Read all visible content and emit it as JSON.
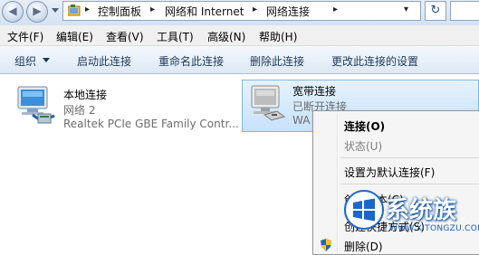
{
  "address_bar": {
    "breadcrumbs": [
      "控制面板",
      "网络和 Internet",
      "网络连接"
    ],
    "refresh_glyph": "↻"
  },
  "menu_bar": {
    "items": [
      "文件(F)",
      "编辑(E)",
      "查看(V)",
      "工具(T)",
      "高级(N)",
      "帮助(H)"
    ]
  },
  "command_bar": {
    "organize_label": "组织",
    "commands": [
      "启动此连接",
      "重命名此连接",
      "删除此连接",
      "更改此连接的设置"
    ]
  },
  "connections": [
    {
      "name": "本地连接",
      "status": "网络  2",
      "device": "Realtek PCIe GBE Family Contr...",
      "icon": "network-adapter-icon"
    },
    {
      "name": "宽带连接",
      "status": "已断开连接",
      "device": "WA",
      "icon": "modem-icon",
      "selected": true
    }
  ],
  "context_menu": {
    "items": [
      {
        "label": "连接(O)",
        "bold": true
      },
      {
        "label": "状态(U)",
        "disabled": true
      },
      {
        "label": "设置为默认连接(F)"
      },
      {
        "label": "创建副本(C)"
      },
      {
        "label": "创建快捷方式(S)"
      },
      {
        "label": "删除(D)"
      }
    ]
  },
  "watermark": {
    "text": "系统族",
    "url": "WWW.XITONGZU.COM"
  },
  "colors": {
    "selection_bg": "#cce4fa",
    "selection_border": "#7db7ea",
    "command_text": "#1e3958"
  }
}
